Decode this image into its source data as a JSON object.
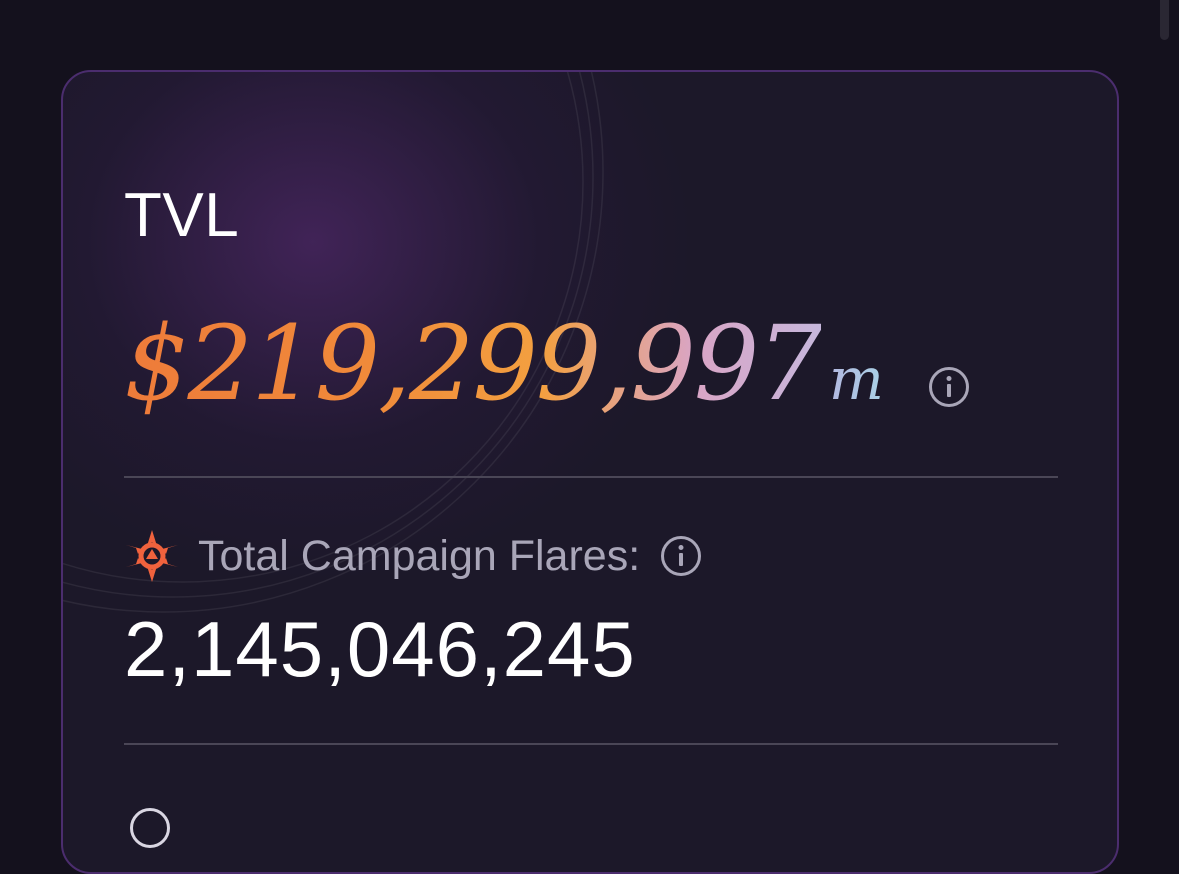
{
  "tvl": {
    "label": "TVL",
    "value": "$219,299,997",
    "suffix": "m",
    "info_icon": "info-icon"
  },
  "flares": {
    "icon": "flare-star-icon",
    "label": "Total Campaign Flares:",
    "info_icon": "info-icon",
    "value": "2,145,046,245"
  },
  "colors": {
    "background": "#14111d",
    "card": "#1c1829",
    "card_border": "#4b2d6e",
    "accent_orange": "#ee7b3a",
    "accent_pink": "#d9a5c6",
    "accent_blue": "#a9d1e6",
    "flare_icon": "#f0623d",
    "muted_text": "#a9a6b8"
  }
}
